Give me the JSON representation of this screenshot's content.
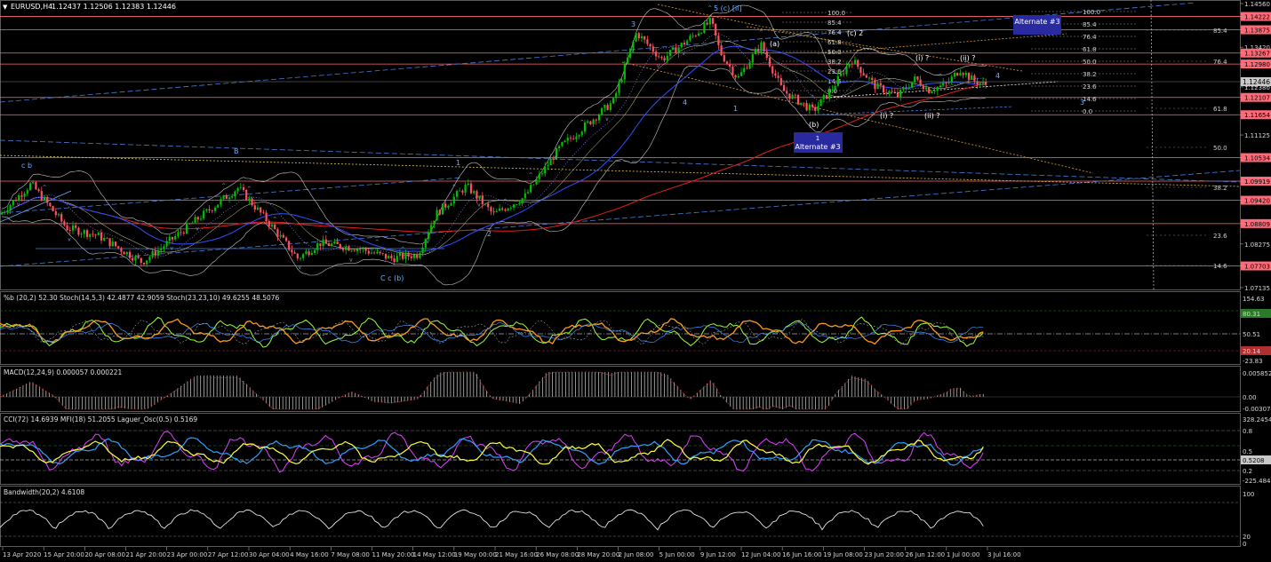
{
  "header": {
    "symbol_tf": "EURUSD,H4",
    "ohlc": "1.12437 1.12506 1.12383 1.12446"
  },
  "price_axis": {
    "ticks": [
      "1.14560",
      "1.14222",
      "1.13875",
      "1.13420",
      "1.13267",
      "1.12980",
      "1.12446",
      "1.12380",
      "1.12107",
      "1.11654",
      "1.11125",
      "1.10534",
      "1.09919",
      "1.09420",
      "1.08809",
      "1.08275",
      "1.07703",
      "1.07135"
    ],
    "current_price": "1.12446",
    "level_lines": [
      "1.14222",
      "1.13875",
      "1.13267",
      "1.12980",
      "1.12107",
      "1.11654",
      "1.10534",
      "1.09919",
      "1.09420",
      "1.08809",
      "1.07703"
    ]
  },
  "time_axis": {
    "labels": [
      "13 Apr 2020",
      "15 Apr 20:00",
      "20 Apr 08:00",
      "21 Apr 20:00",
      "23 Apr 00:00",
      "27 Apr 12:00",
      "30 Apr 04:00",
      "4 May 16:00",
      "7 May 08:00",
      "11 May 20:00",
      "14 May 12:00",
      "19 May 00:00",
      "21 May 16:00",
      "26 May 08:00",
      "28 May 20:00",
      "2 Jun 08:00",
      "5 Jun 00:00",
      "9 Jun 12:00",
      "12 Jun 04:00",
      "16 Jun 16:00",
      "19 Jun 08:00",
      "23 Jun 20:00",
      "26 Jun 12:00",
      "1 Jul 00:00",
      "3 Jul 16:00"
    ]
  },
  "annotations": {
    "alternate_box_top": "Alternate #3",
    "alternate_box_bottom_num": "1",
    "alternate_box_bottom": "Alternate #3",
    "wave_labels": [
      "c b",
      "B",
      "C c (b)",
      "1",
      "2",
      "3",
      "4",
      "5 (c) [ii]",
      "(a)",
      "(b)",
      "(c) 2",
      "(i) ?",
      "(ii) ?",
      "(i) ?",
      "(ii) ?",
      "1",
      "4",
      "3"
    ],
    "fib_right": [
      "100.0",
      "85.4",
      "76.4",
      "61.8",
      "50.0",
      "38.2",
      "23.6",
      "14.6",
      "0.0"
    ],
    "fib_mid": [
      "100.0",
      "85.4",
      "76.4",
      "61.8",
      "50.0",
      "38.2",
      "23.6",
      "14.6",
      "0.0"
    ],
    "fib_outer": [
      "85.4",
      "76.4",
      "61.8",
      "50.0",
      "38.2",
      "23.6",
      "14.6"
    ]
  },
  "panels": {
    "stoch": {
      "label": "%b (20,2) 52.30  Stoch(14,5,3) 42.4877 42.9059  Stoch(23,23,10) 49.6255 48.5076",
      "ticks": [
        "154.63",
        "80.31",
        "50.51",
        "20.14",
        "-23.83"
      ]
    },
    "macd": {
      "label": "MACD(12,24,9) 0.000057 0.000221",
      "ticks": [
        "0.005852",
        "0.00",
        "-0.003074"
      ]
    },
    "cci": {
      "label": "CCI(72) 14.6939  MFI(18) 51.2055  Laguer_Osc(0.5) 0.5169",
      "ticks": [
        "328.2454",
        "0.8",
        "0.5",
        "0.5208",
        "0.2",
        "-225.4845"
      ]
    },
    "bandwidth": {
      "label": "Bandwidth(20,2) 4.6108",
      "ticks": [
        "100",
        "20",
        "0"
      ]
    }
  },
  "colors": {
    "background": "#000000",
    "bull_candle": "#00c000",
    "bear_candle": "#ff5060",
    "level_line": "#ff6a78",
    "ma_red": "#e02020",
    "ma_blue": "#3050ff",
    "bollinger": "#c8c8c8",
    "trend_blue": "#4a7ed8",
    "fib_orange": "#d9a03a",
    "stoch_green": "#9cff3c",
    "stoch_orange": "#ff9a1a",
    "cci_magenta": "#e040ff",
    "cci_yellow": "#ffff40",
    "cci_blue": "#30a0ff",
    "alt_box": "#2a2aa0"
  }
}
